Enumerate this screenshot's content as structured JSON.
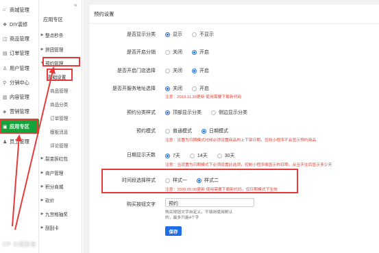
{
  "mainnav": [
    {
      "icon": "home-icon",
      "glyph": "⌂",
      "label": "商城管理"
    },
    {
      "icon": "diy-icon",
      "glyph": "❖",
      "label": "DIY装修"
    },
    {
      "icon": "goods-icon",
      "glyph": "◫",
      "label": "商品管理"
    },
    {
      "icon": "order-icon",
      "glyph": "▤",
      "label": "订单管理"
    },
    {
      "icon": "user-icon",
      "glyph": "♙",
      "label": "用户管理"
    },
    {
      "icon": "share-icon",
      "glyph": "⚲",
      "label": "分销中心"
    },
    {
      "icon": "content-icon",
      "glyph": "▥",
      "label": "内容管理"
    },
    {
      "icon": "marketing-icon",
      "glyph": "◈",
      "label": "营销管理"
    },
    {
      "icon": "apps-icon",
      "glyph": "▣",
      "label": "应用专区"
    },
    {
      "icon": "staff-icon",
      "glyph": "♟",
      "label": "员工管理"
    }
  ],
  "subnav": {
    "title": "应用专区",
    "rows": [
      {
        "type": "group",
        "label": "整点秒杀"
      },
      {
        "type": "group",
        "label": "拼团管理"
      },
      {
        "type": "group-open",
        "label": "预约管理"
      },
      {
        "type": "current",
        "label": "基础设置"
      },
      {
        "type": "child",
        "label": "商品管理"
      },
      {
        "type": "child",
        "label": "商品分类"
      },
      {
        "type": "child",
        "label": "订单管理"
      },
      {
        "type": "child",
        "label": "模板消息"
      },
      {
        "type": "child",
        "label": "评论管理"
      },
      {
        "type": "group",
        "label": "裂变拆红包"
      },
      {
        "type": "group",
        "label": "商户管理"
      },
      {
        "type": "group",
        "label": "积分商城"
      },
      {
        "type": "group",
        "label": "砍价"
      },
      {
        "type": "group",
        "label": "九宫格抽奖"
      },
      {
        "type": "group",
        "label": "刮刮卡"
      }
    ]
  },
  "panel": {
    "title": "预约设置",
    "rows": [
      {
        "label": "是否显示分类",
        "options": [
          {
            "label": "显示",
            "on": true
          },
          {
            "label": "不显示",
            "on": false
          }
        ],
        "note": ""
      },
      {
        "label": "是否开启分销",
        "options": [
          {
            "label": "关闭",
            "on": false
          },
          {
            "label": "开启",
            "on": true
          }
        ],
        "note": ""
      },
      {
        "label": "是否开启门店选择",
        "options": [
          {
            "label": "关闭",
            "on": false
          },
          {
            "label": "开启",
            "on": true
          }
        ],
        "note": ""
      },
      {
        "label": "是否开服务地址选择",
        "options": [
          {
            "label": "关闭",
            "on": true
          },
          {
            "label": "开启",
            "on": false
          }
        ],
        "note": "注意：2019.11.20更新 使用需要下载新代码"
      },
      {
        "label": "预约分类样式",
        "options": [
          {
            "label": "顶部显示分类",
            "on": true
          },
          {
            "label": "侧边显示分类",
            "on": false
          }
        ],
        "note": ""
      },
      {
        "label": "预约模式",
        "options": [
          {
            "label": "普通模式",
            "on": false
          },
          {
            "label": "日期模式",
            "on": true
          }
        ],
        "note": "注意：设置为日期模式时候必须设置商品的上下架日期，否则小程序不会显示预约商品"
      },
      {
        "label": "日期显示天数",
        "options": [
          {
            "label": "7天",
            "on": true
          },
          {
            "label": "14天",
            "on": false
          },
          {
            "label": "30天",
            "on": false
          }
        ],
        "note": "注意：当设置为日期模式下必须设置此选项，控制小程序端显示的日期，从当天往后显示多少天"
      },
      {
        "label": "时间段选择样式",
        "options": [
          {
            "label": "样式一",
            "on": false
          },
          {
            "label": "样式二",
            "on": true
          }
        ],
        "note": "注意：2020.05.06更新 使用需要下载新代码，仅日期模式下生效"
      }
    ],
    "button_text_label": "购买按钮文字",
    "button_text_value": "预约",
    "button_text_hint": "购买按钮文字自定义，不填则使用默认的，最多只能4个字",
    "save_label": "保存"
  },
  "watermark": "CP 大眼影音",
  "colors": {
    "primary": "#1e6ee6",
    "active_nav": "#17a23c",
    "note": "#e0453a",
    "annotation": "#e63a3a"
  }
}
